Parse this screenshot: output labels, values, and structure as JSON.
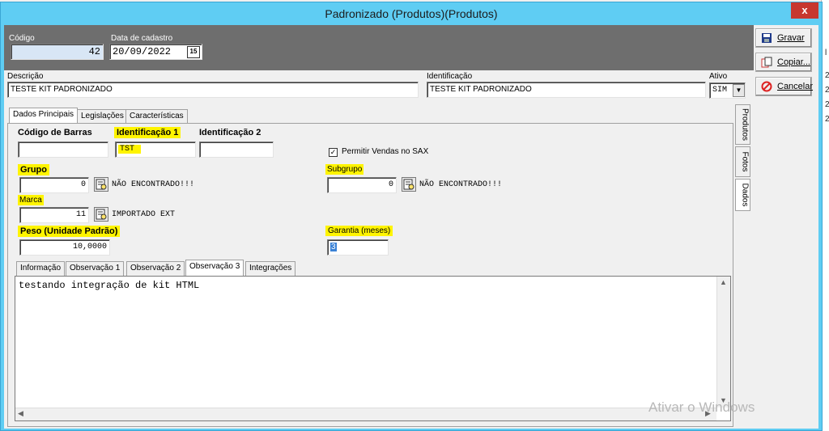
{
  "window": {
    "title": "Padronizado (Produtos)(Produtos)",
    "close_label": "x"
  },
  "header": {
    "codigo_label": "Código",
    "codigo_value": "42",
    "data_label": "Data de cadastro",
    "data_value": "20/09/2022",
    "calendar_glyph": "15"
  },
  "descricao": {
    "label": "Descrição",
    "value": "TESTE KIT PADRONIZADO"
  },
  "identificacao": {
    "label": "Identificação",
    "value": "TESTE KIT PADRONIZADO"
  },
  "ativo": {
    "label": "Ativo",
    "value": "SIM"
  },
  "actions": {
    "gravar": "Gravar",
    "copiar": "Copiar...",
    "cancelar": "Cancelar"
  },
  "main_tabs": [
    "Dados Principais",
    "Legislações",
    "Características"
  ],
  "side_tabs": [
    "Produtos",
    "Fotos",
    "Dados"
  ],
  "fields": {
    "codigo_barras_label": "Código de Barras",
    "codigo_barras_value": "",
    "ident1_label": "Identificação 1",
    "ident1_value": "TST",
    "ident2_label": "Identificação 2",
    "ident2_value": "",
    "permitir_vendas_label": "Permitir Vendas no SAX",
    "permitir_vendas_checked": true,
    "grupo_label": "Grupo",
    "grupo_value": "0",
    "grupo_desc": "NÃO ENCONTRADO!!!",
    "subgrupo_label": "Subgrupo",
    "subgrupo_value": "0",
    "subgrupo_desc": "NÃO ENCONTRADO!!!",
    "marca_label": "Marca",
    "marca_value": "11",
    "marca_desc": "IMPORTADO EXT",
    "peso_label": "Peso (Unidade Padrão)",
    "peso_value": "10,0000",
    "garantia_label": "Garantia (meses)",
    "garantia_value": "3"
  },
  "sub_tabs": [
    "Informação",
    "Observação 1",
    "Observação 2",
    "Observação 3",
    "Integrações"
  ],
  "observacao_text": "testando integração de kit HTML",
  "watermark": "Ativar o Windows",
  "background_right": [
    "l",
    "2",
    "2",
    "2",
    "2"
  ],
  "colors": {
    "title_bar": "#5fcdf3",
    "highlight": "#fff400",
    "close": "#c7372f",
    "header_band": "#6e6e6e"
  }
}
